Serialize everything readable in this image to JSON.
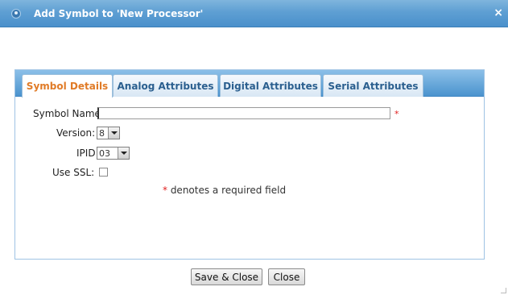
{
  "dialog": {
    "title": "Add Symbol to 'New Processor'",
    "close_glyph": "×"
  },
  "tabs": [
    {
      "label": "Symbol Details",
      "active": true
    },
    {
      "label": "Analog Attributes",
      "active": false
    },
    {
      "label": "Digital Attributes",
      "active": false
    },
    {
      "label": "Serial Attributes",
      "active": false
    }
  ],
  "form": {
    "symbol_name_label": "Symbol Name",
    "symbol_name_value": "",
    "required_star": "*",
    "version_label": "Version:",
    "version_value": "8",
    "ipid_label": "IPID",
    "ipid_value": "03",
    "use_ssl_label": "Use SSL:",
    "use_ssl_checked": false,
    "note_star": "*",
    "note_text": " denotes a required field"
  },
  "buttons": {
    "save_close": "Save & Close",
    "close": "Close"
  },
  "colors": {
    "titlebar": "#5e9fd3",
    "active_tab_text": "#e07b27",
    "tab_text": "#2b5f8f",
    "required": "#e02020"
  }
}
